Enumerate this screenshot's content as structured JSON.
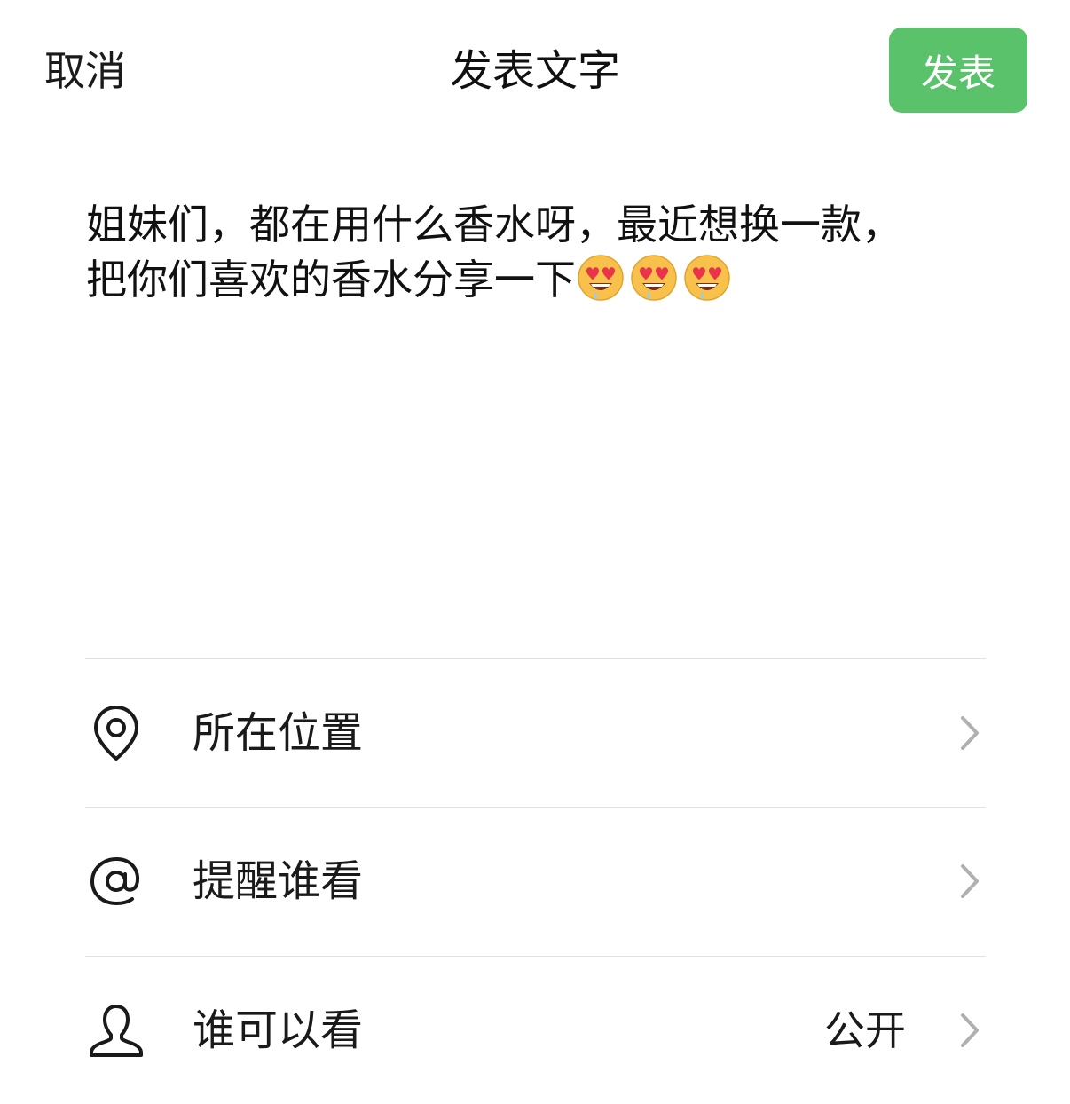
{
  "header": {
    "cancel_label": "取消",
    "title": "发表文字",
    "post_label": "发表"
  },
  "compose": {
    "text_line1": "姐妹们，都在用什么香水呀，最近想换一款，",
    "text_line2": "把你们喜欢的香水分享一下",
    "emojis": [
      "heart-eyes-drooling-emoji",
      "heart-eyes-drooling-emoji",
      "heart-eyes-drooling-emoji"
    ]
  },
  "options": {
    "location": {
      "icon": "location-pin-icon",
      "label": "所在位置"
    },
    "mention": {
      "icon": "at-sign-icon",
      "label": "提醒谁看"
    },
    "visibility": {
      "icon": "person-icon",
      "label": "谁可以看",
      "value": "公开"
    }
  },
  "colors": {
    "accent": "#5ac26b",
    "divider": "#e3e3e3",
    "chevron": "#b0b0b0"
  }
}
